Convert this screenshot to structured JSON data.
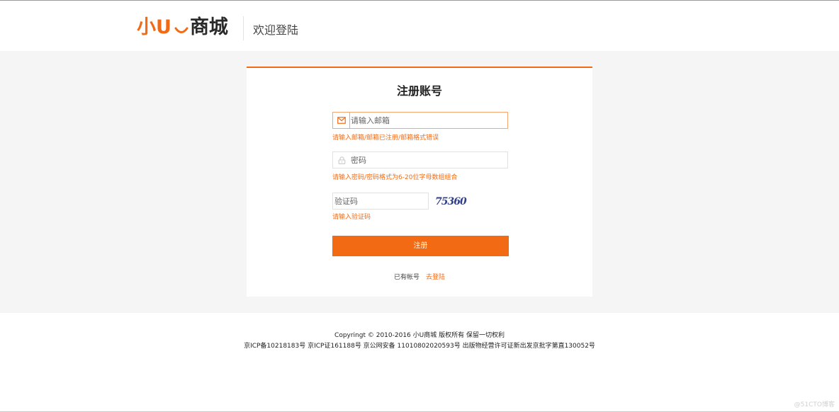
{
  "header": {
    "logo": {
      "part1": "小U",
      "part2": "商城",
      "smile_icon": "smile-icon"
    },
    "subtitle": "欢迎登陆"
  },
  "colors": {
    "accent": "#f26b14",
    "band": "#f5f5f5",
    "captcha_text": "#2f3f8a"
  },
  "form": {
    "title": "注册账号",
    "email": {
      "icon": "envelope-icon",
      "placeholder": "请输入邮箱",
      "value": "",
      "hint": "请输入邮箱/邮箱已注册/邮箱格式错误"
    },
    "password": {
      "icon": "lock-icon",
      "placeholder": "密码",
      "value": "",
      "hint": "请输入密码/密码格式为6-20位字母数组组合"
    },
    "captcha": {
      "placeholder": "验证码",
      "value": "",
      "image_text": "75360",
      "hint": "请输入验证码"
    },
    "submit_label": "注册",
    "has_account_text": "已有帐号",
    "login_link": "去登陆"
  },
  "footer": {
    "line1": "Copyringt © 2010-2016 小U商城 版权所有 保留一切权利",
    "line2": "京ICP备10218183号 京ICP证161188号 京公网安备 11010802020593号 出版物经营许可证新出发京批字第直130052号"
  },
  "watermark": "@51CTO博客"
}
